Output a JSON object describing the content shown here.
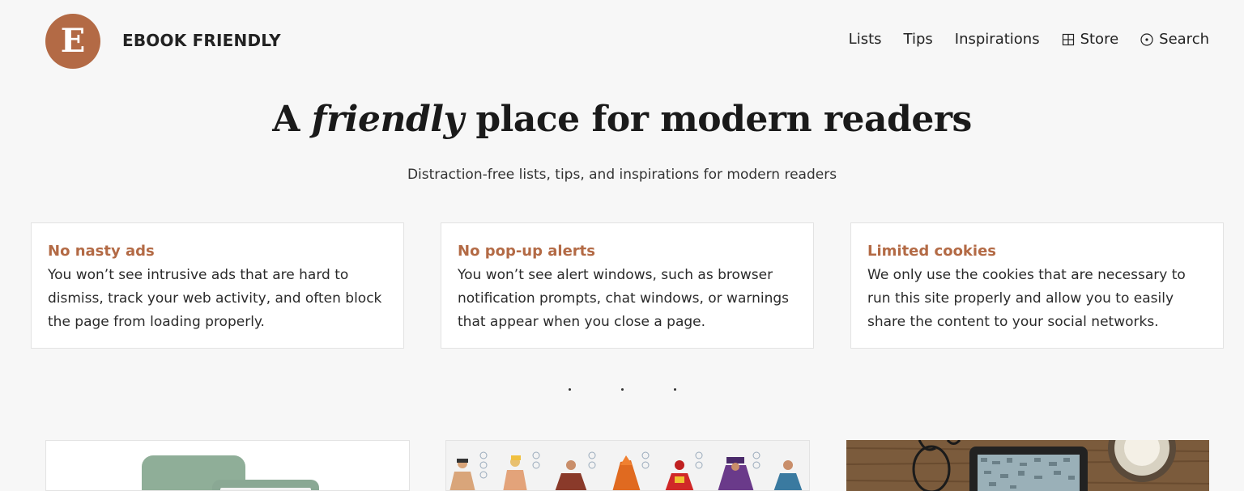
{
  "header": {
    "logo_letter": "E",
    "brand": "EBOOK FRIENDLY",
    "nav": [
      {
        "label": "Lists"
      },
      {
        "label": "Tips"
      },
      {
        "label": "Inspirations"
      },
      {
        "label": "Store",
        "icon": "grid-icon"
      },
      {
        "label": "Search",
        "icon": "search-circle-icon"
      }
    ]
  },
  "hero": {
    "title_pre": "A ",
    "title_em": "friendly",
    "title_post": " place for modern readers",
    "subtitle": "Distraction-free lists, tips, and inspirations for modern readers"
  },
  "features": [
    {
      "title": "No nasty ads",
      "body": "You won’t see intrusive ads that are hard to dismiss, track your web activity, and often block the page from loading properly."
    },
    {
      "title": "No pop-up alerts",
      "body": "You won’t see alert windows, such as browser notification prompts, chat windows, or warnings that appear when you close a page."
    },
    {
      "title": "Limited cookies",
      "body": "We only use the cookies that are necessary to run this site properly and allow you to easily share the content to your social networks."
    }
  ],
  "colors": {
    "accent": "#b36a45",
    "background": "#f7f7f7"
  }
}
